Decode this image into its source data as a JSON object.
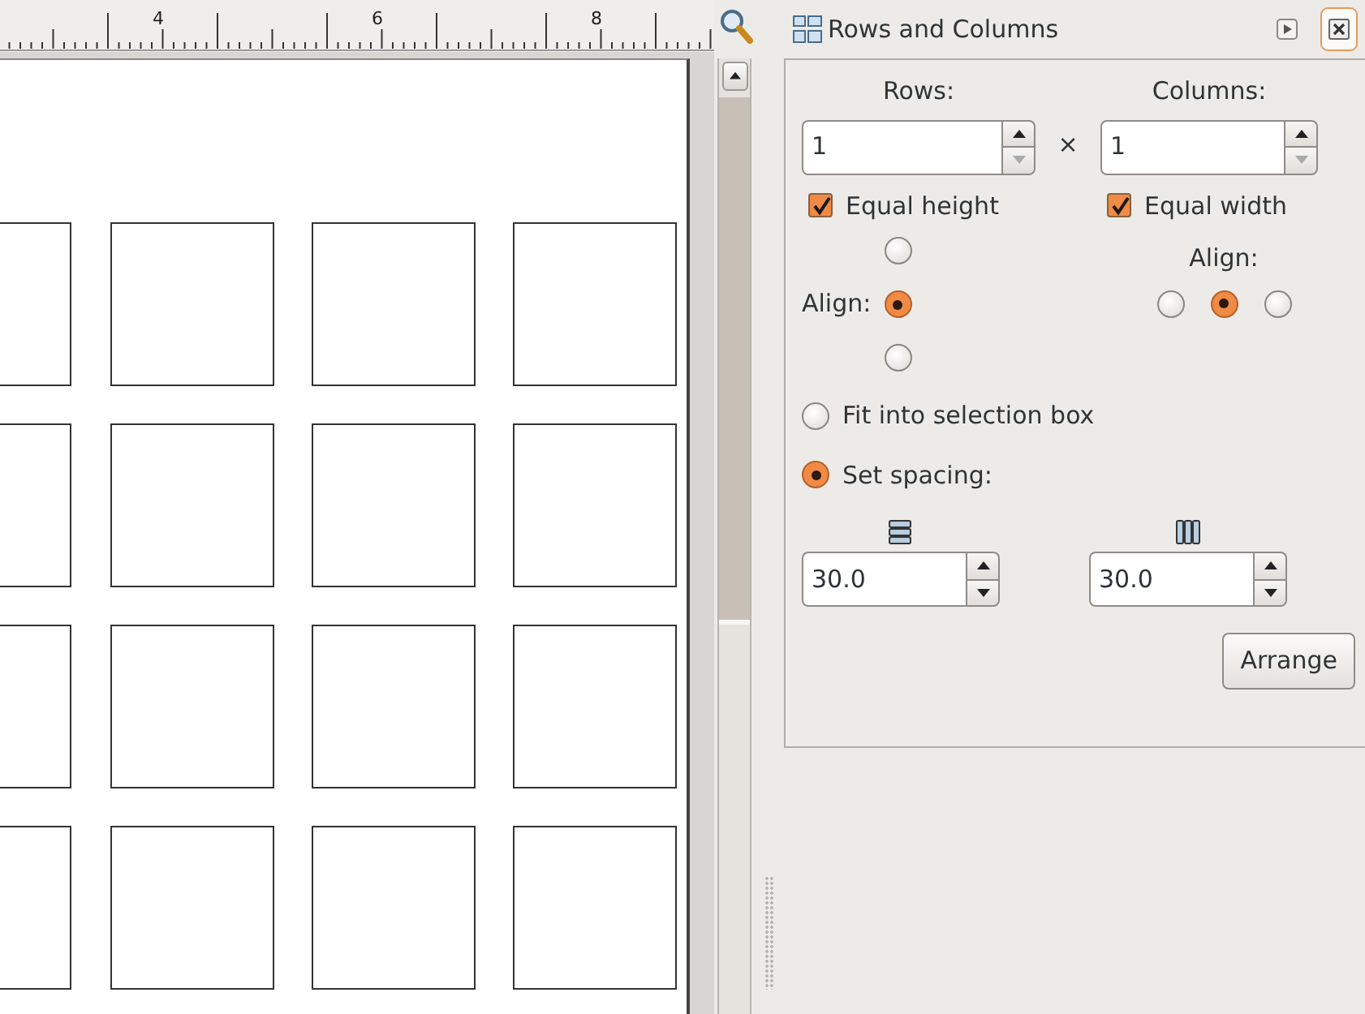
{
  "ruler": {
    "labels": [
      "4",
      "6",
      "8"
    ]
  },
  "panel": {
    "title": "Rows and Columns",
    "rows_label": "Rows:",
    "columns_label": "Columns:",
    "times": "×",
    "rows_value": "1",
    "columns_value": "1",
    "equal_height": {
      "label": "Equal height",
      "checked": true
    },
    "equal_width": {
      "label": "Equal width",
      "checked": true
    },
    "row_align": {
      "label": "Align:",
      "options": [
        {
          "selected": false
        },
        {
          "selected": true
        },
        {
          "selected": false
        }
      ]
    },
    "column_align": {
      "label": "Align:",
      "options": [
        {
          "selected": false
        },
        {
          "selected": true
        },
        {
          "selected": false
        }
      ]
    },
    "modes": [
      {
        "label": "Fit into selection box",
        "selected": false
      },
      {
        "label": "Set spacing:",
        "selected": true
      }
    ],
    "row_spacing": "30.0",
    "column_spacing": "30.0",
    "arrange_button": "Arrange"
  }
}
